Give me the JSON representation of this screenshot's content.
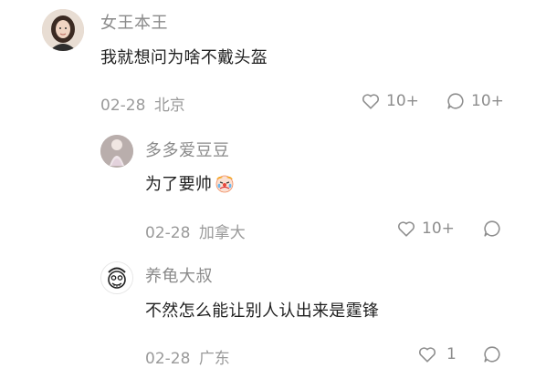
{
  "comments": [
    {
      "username": "女王本王",
      "content": "我就想问为啥不戴头盔",
      "date": "02-28",
      "location": "北京",
      "likes": "10+",
      "replies": "10+",
      "avatar_icon": "woman-portrait-avatar"
    },
    {
      "username": "多多爱豆豆",
      "content": "为了要帅",
      "emoji_icon": "crying-clown-emoji",
      "date": "02-28",
      "location": "加拿大",
      "likes": "10+",
      "avatar_icon": "doll-avatar"
    },
    {
      "username": "养龟大叔",
      "content": "不然怎么能让别人认出来是霆锋",
      "date": "02-28",
      "location": "广东",
      "likes": "1",
      "avatar_icon": "cartoon-face-avatar"
    }
  ],
  "colors": {
    "username": "#8a8a8a",
    "content": "#1f1f1f",
    "meta": "#9a9a9a",
    "icon": "#8d8d8d"
  }
}
